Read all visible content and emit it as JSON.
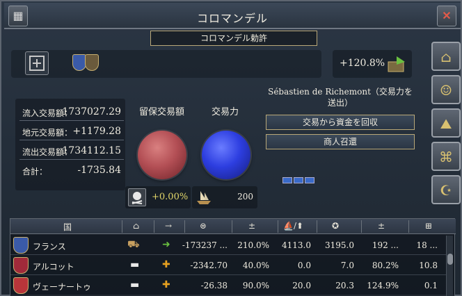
{
  "window": {
    "title": "コロマンデル",
    "close_glyph": "✕"
  },
  "charter": {
    "label": "コロマンデル勅許"
  },
  "summary": {
    "percentage": "+120.8%"
  },
  "stats": [
    {
      "label": "流入交易額：",
      "value": "1737027.29"
    },
    {
      "label": "地元交易額：",
      "value": "+1179.28"
    },
    {
      "label": "流出交易額：",
      "value": "1734112.15"
    },
    {
      "label": "合計：",
      "value": "-1735.84"
    }
  ],
  "columns": {
    "retained": "留保交易額",
    "power": "交易力"
  },
  "bottom": {
    "retained_pct": "+0.00%",
    "power_val": "200"
  },
  "owner": {
    "name": "Sébastien de Richemont（交易力を送出）"
  },
  "actions": {
    "collect": "交易から資金を回収",
    "recall": "商人召還"
  },
  "table": {
    "headers": {
      "country": "国",
      "c2": "⌂",
      "c3": "→",
      "c4": "⊜",
      "c5": "±",
      "c6": "⛵/⬆",
      "c7": "✪",
      "c8": "±",
      "c9": "⊞"
    },
    "rows": [
      {
        "name": "フランス",
        "v1": "-173237 ...",
        "v2": "210.0%",
        "v3": "4113.0",
        "v4": "3195.0",
        "v5": "192 ...",
        "v6": "18 ...",
        "flag_color": "#3a5aa8",
        "arrow": "➜",
        "arrow_color": "#6ac040",
        "c2": "⛟"
      },
      {
        "name": "アルコット",
        "v1": "-2342.70",
        "v2": "40.0%",
        "v3": "0.0",
        "v4": "7.0",
        "v5": "80.2%",
        "v6": "10.8",
        "flag_color": "#a02a3a",
        "arrow": "✚",
        "arrow_color": "#e6a020",
        "c2": "▬"
      },
      {
        "name": "ヴェーナートゥ",
        "v1": "-26.38",
        "v2": "90.0%",
        "v3": "20.0",
        "v4": "20.3",
        "v5": "124.9%",
        "v6": "0.1",
        "flag_color": "#b8353a",
        "arrow": "✚",
        "arrow_color": "#e6a020",
        "c2": "▬"
      }
    ]
  }
}
